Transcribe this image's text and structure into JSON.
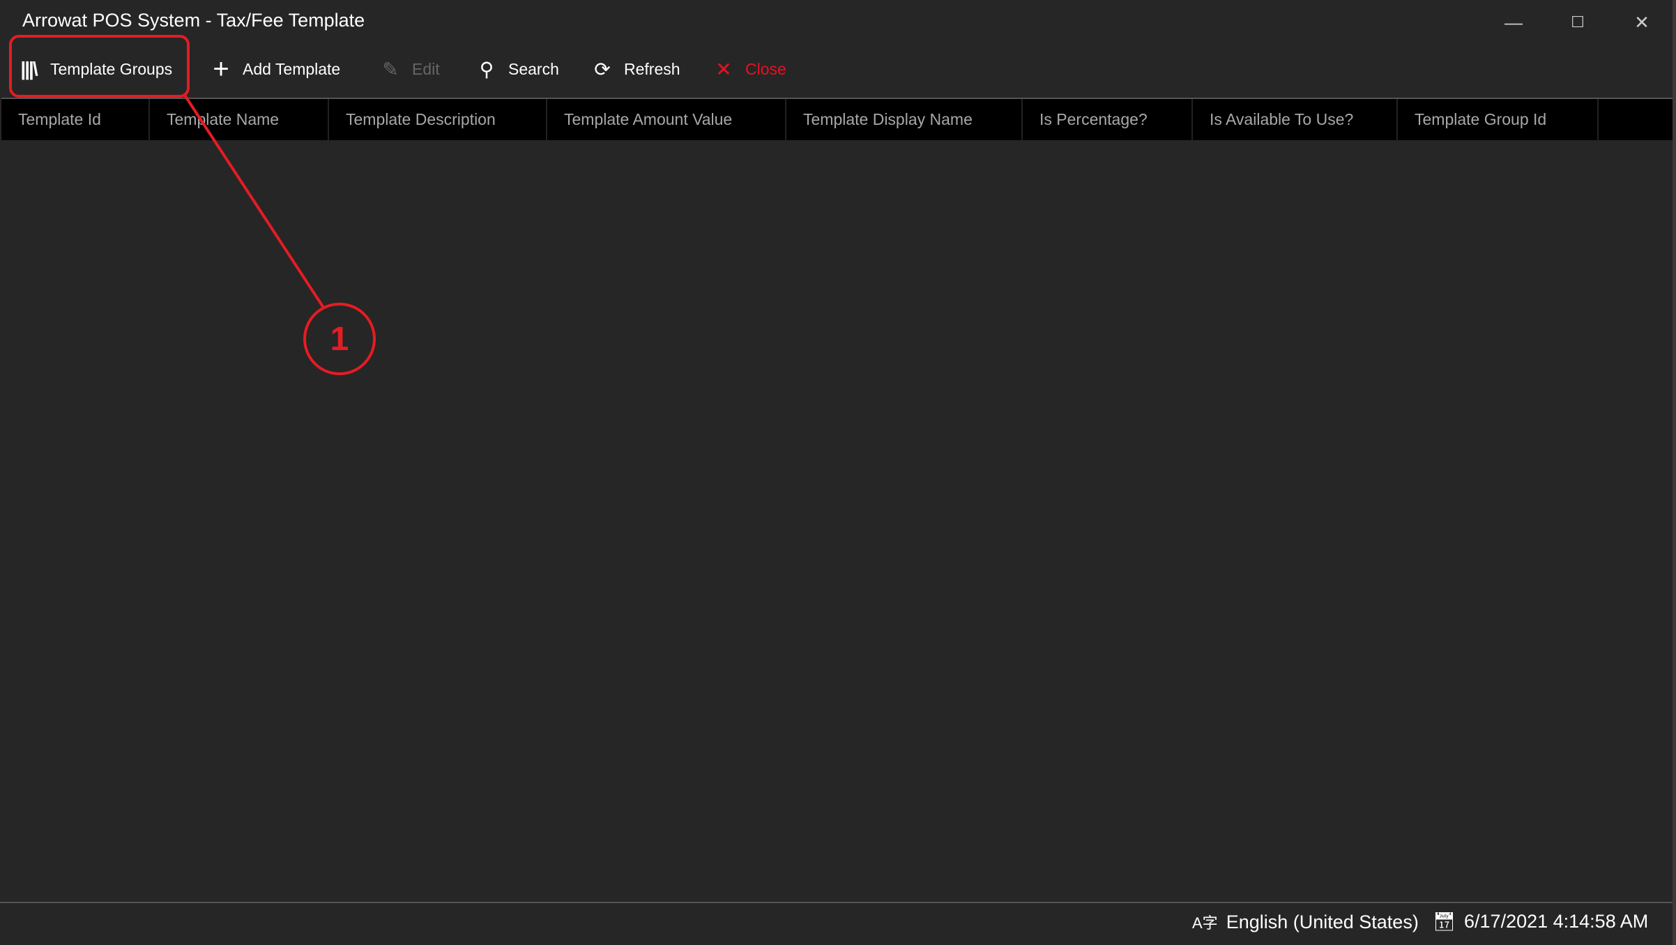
{
  "window": {
    "title": "Arrowat POS System - Tax/Fee Template",
    "controls": [
      "minimize",
      "maximize",
      "close"
    ]
  },
  "toolbar": {
    "template_groups": {
      "label": "Template Groups",
      "icon": "library-icon"
    },
    "add_template": {
      "label": "Add Template",
      "icon": "plus-icon"
    },
    "edit": {
      "label": "Edit",
      "icon": "pencil-icon",
      "disabled": true
    },
    "search": {
      "label": "Search",
      "icon": "search-icon"
    },
    "refresh": {
      "label": "Refresh",
      "icon": "refresh-icon"
    },
    "close": {
      "label": "Close",
      "icon": "close-icon",
      "color": "#e81123"
    }
  },
  "table": {
    "columns": [
      "Template Id",
      "Template Name",
      "Template Description",
      "Template Amount Value",
      "Template Display Name",
      "Is Percentage?",
      "Is Available To Use?",
      "Template Group Id"
    ],
    "rows": []
  },
  "annotation": {
    "number": "1",
    "color": "#e51c23"
  },
  "status": {
    "language": "English (United States)",
    "datetime": "6/17/2021 4:14:58 AM"
  }
}
